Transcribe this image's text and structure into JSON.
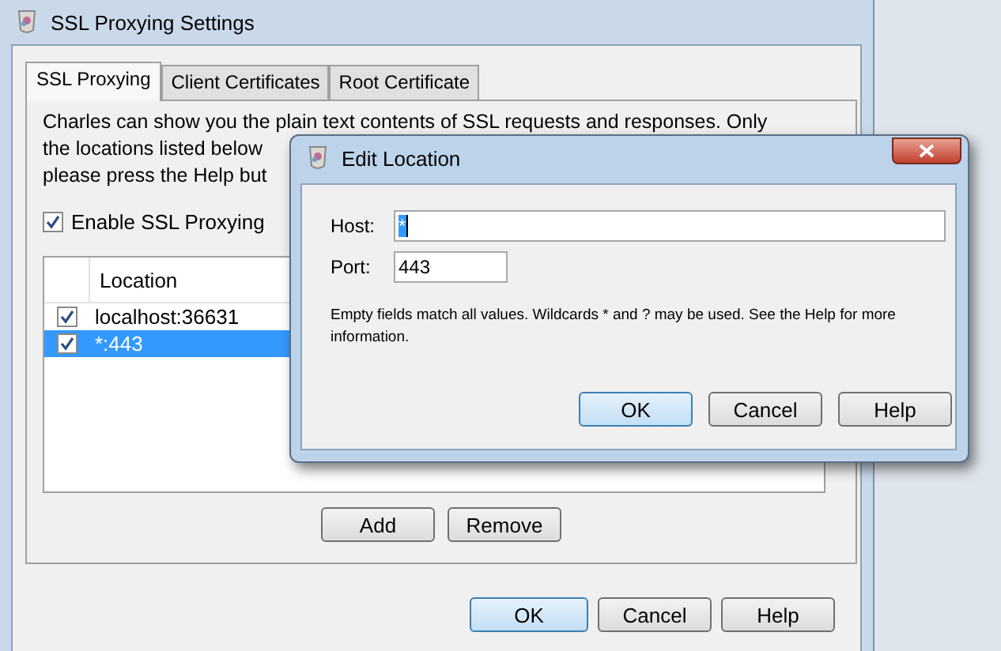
{
  "window": {
    "title": "SSL Proxying Settings"
  },
  "tabs": [
    {
      "label": "SSL Proxying",
      "selected": true
    },
    {
      "label": "Client Certificates",
      "selected": false
    },
    {
      "label": "Root Certificate",
      "selected": false
    }
  ],
  "description_lines": [
    "Charles can show you the plain text contents of SSL requests and responses. Only",
    "the locations listed below",
    "please press the Help but"
  ],
  "enable_ssl_proxying": {
    "label": "Enable SSL Proxying",
    "checked": true
  },
  "table": {
    "columns": [
      "Location"
    ],
    "rows": [
      {
        "location": "localhost:36631",
        "checked": true,
        "selected": false
      },
      {
        "location": "*:443",
        "checked": true,
        "selected": true
      }
    ]
  },
  "table_buttons": [
    "Add",
    "Remove"
  ],
  "buttons": [
    {
      "label": "OK",
      "default": true
    },
    {
      "label": "Cancel",
      "default": false
    },
    {
      "label": "Help",
      "default": false
    }
  ],
  "dialog": {
    "title": "Edit Location",
    "fields": [
      {
        "label": "Host:",
        "value": "*"
      },
      {
        "label": "Port:",
        "value": "443"
      }
    ],
    "note": "Empty fields match all values. Wildcards * and ? may be used. See the Help for more information.",
    "buttons": [
      {
        "label": "OK",
        "default": true
      },
      {
        "label": "Cancel",
        "default": false
      },
      {
        "label": "Help",
        "default": false
      }
    ]
  }
}
